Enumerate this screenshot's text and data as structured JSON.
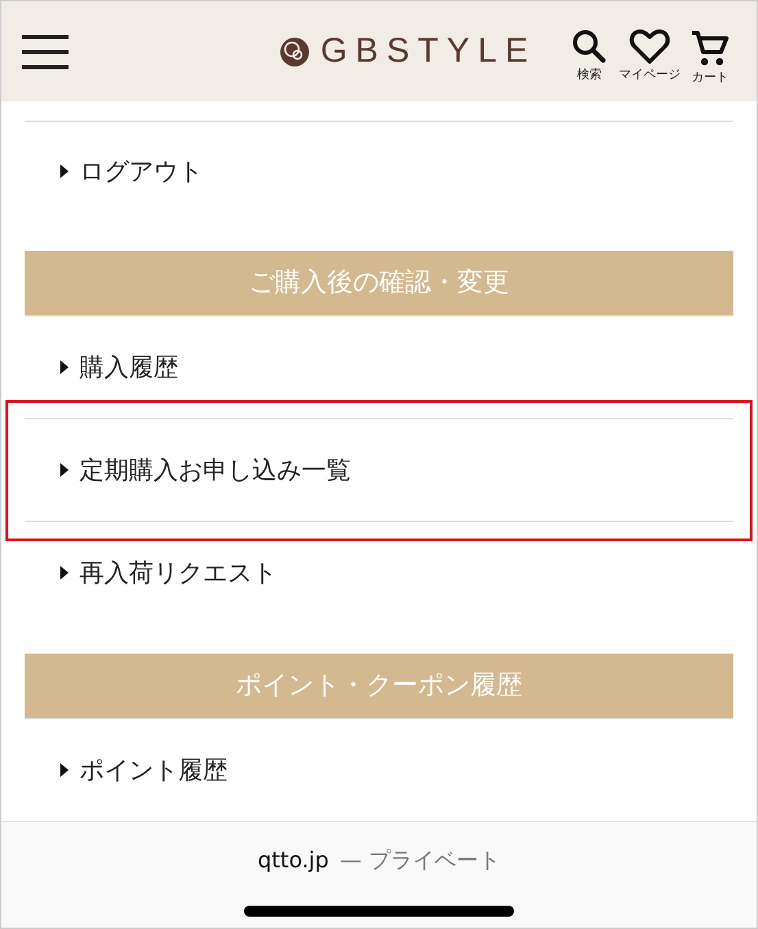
{
  "header": {
    "logo": "GBSTYLE",
    "actions": [
      {
        "kind": "search",
        "label": "検索"
      },
      {
        "kind": "heart",
        "label": "マイページ"
      },
      {
        "kind": "cart",
        "label": "カート"
      }
    ]
  },
  "menu": [
    {
      "kind": "link",
      "label": "ログアウト",
      "highlighted": false
    },
    {
      "kind": "section",
      "label": "ご購入後の確認・変更"
    },
    {
      "kind": "link",
      "label": "購入履歴",
      "highlighted": false
    },
    {
      "kind": "link",
      "label": "定期購入お申し込み一覧",
      "highlighted": true
    },
    {
      "kind": "link",
      "label": "再入荷リクエスト",
      "highlighted": false
    },
    {
      "kind": "section",
      "label": "ポイント・クーポン履歴"
    },
    {
      "kind": "link",
      "label": "ポイント履歴",
      "highlighted": false
    }
  ],
  "address_bar": {
    "domain": "qtto.jp",
    "mode": "— プライベート"
  }
}
